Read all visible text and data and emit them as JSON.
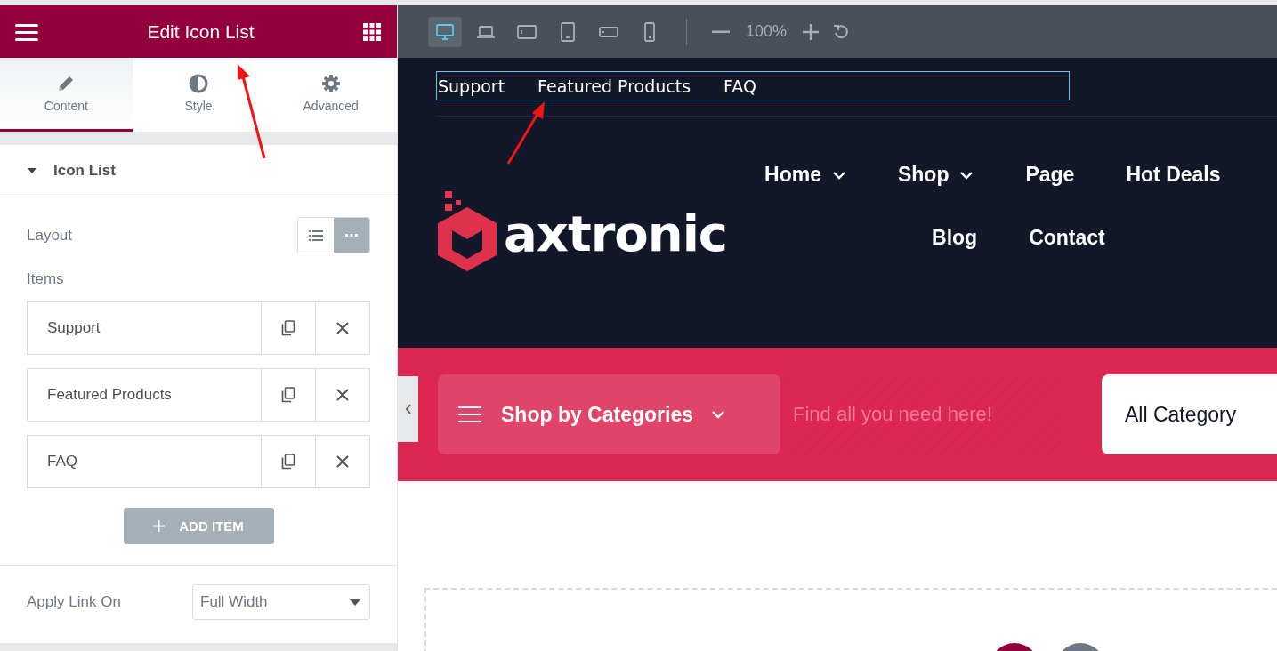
{
  "panel": {
    "title": "Edit Icon List",
    "tabs": [
      {
        "label": "Content",
        "selected": true
      },
      {
        "label": "Style",
        "selected": false
      },
      {
        "label": "Advanced",
        "selected": false
      }
    ],
    "section": {
      "title": "Icon List",
      "expanded": true
    },
    "layout": {
      "label": "Layout",
      "options": [
        {
          "selected": false
        },
        {
          "selected": true
        }
      ]
    },
    "items_label": "Items",
    "items": [
      {
        "label": "Support"
      },
      {
        "label": "Featured Products"
      },
      {
        "label": "FAQ"
      }
    ],
    "add_button": "ADD ITEM",
    "apply_link": {
      "label": "Apply Link On",
      "value": "Full Width"
    }
  },
  "toolbar": {
    "devices": [
      {
        "selected": true
      },
      {
        "selected": false
      },
      {
        "selected": false
      },
      {
        "selected": false
      },
      {
        "selected": false
      },
      {
        "selected": false
      }
    ],
    "zoom": "100%"
  },
  "preview": {
    "top_links": [
      "Support",
      "Featured Products",
      "FAQ"
    ],
    "logo": "axtronic",
    "nav_rows": [
      [
        {
          "label": "Home",
          "dropdown": true
        },
        {
          "label": "Shop",
          "dropdown": true
        },
        {
          "label": "Page",
          "dropdown": false
        },
        {
          "label": "Hot Deals",
          "dropdown": false
        }
      ],
      [
        {
          "label": "Blog",
          "dropdown": false
        },
        {
          "label": "Contact",
          "dropdown": false
        }
      ]
    ],
    "categories_button": "Shop by Categories",
    "search": {
      "placeholder": "Find all you need here!"
    },
    "category_select": "All Category"
  }
}
